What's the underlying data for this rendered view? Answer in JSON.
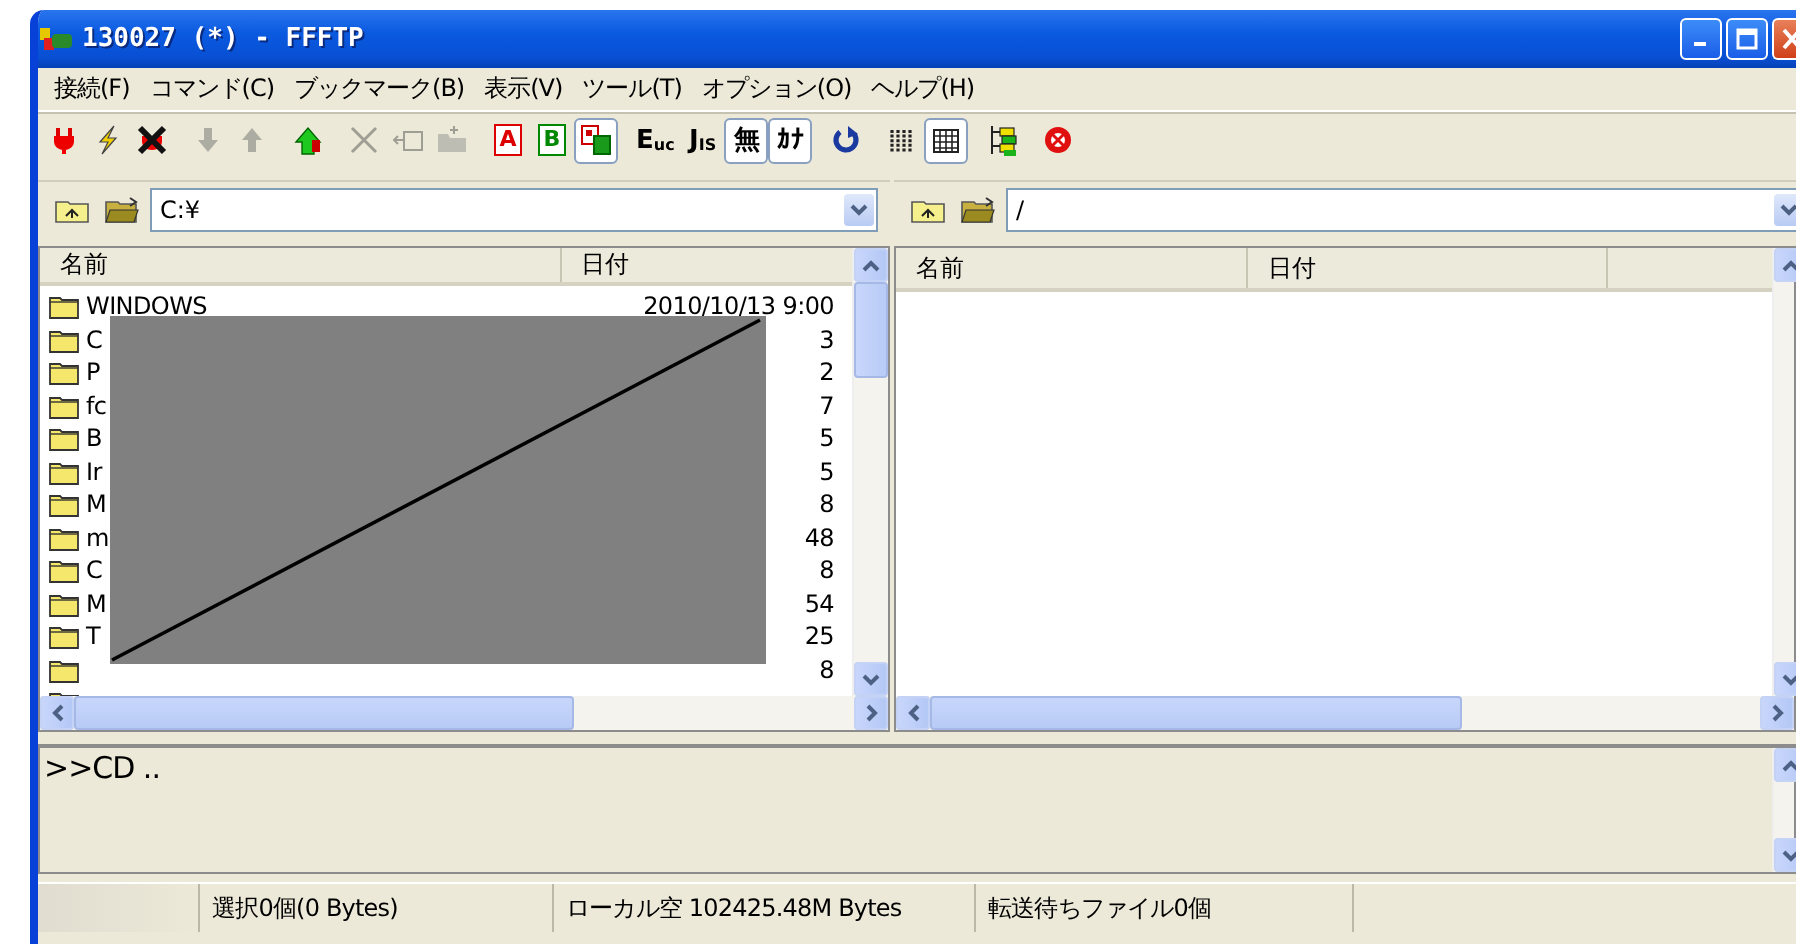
{
  "window": {
    "title": "130027 (*) - FFFTP"
  },
  "menu": [
    "接続(F)",
    "コマンド(C)",
    "ブックマーク(B)",
    "表示(V)",
    "ツール(T)",
    "オプション(O)",
    "ヘルプ(H)"
  ],
  "toolbar": [
    {
      "kind": "connect",
      "selected": false,
      "disabled": false
    },
    {
      "kind": "quick-connect",
      "selected": false,
      "disabled": false
    },
    {
      "kind": "disconnect",
      "selected": false,
      "disabled": false
    },
    {
      "kind": "download",
      "selected": false,
      "disabled": true
    },
    {
      "kind": "upload",
      "selected": false,
      "disabled": true
    },
    {
      "kind": "mirror-upload",
      "selected": false,
      "disabled": false
    },
    {
      "kind": "delete",
      "selected": false,
      "disabled": true
    },
    {
      "kind": "rename",
      "selected": false,
      "disabled": true
    },
    {
      "kind": "new-folder",
      "selected": false,
      "disabled": true
    },
    {
      "kind": "ascii",
      "label": "A",
      "selected": false,
      "disabled": false
    },
    {
      "kind": "binary",
      "label": "B",
      "selected": false,
      "disabled": false
    },
    {
      "kind": "auto-mode",
      "selected": true,
      "disabled": false
    },
    {
      "kind": "code",
      "label": "E$_{uc}$",
      "selected": false,
      "disabled": false
    },
    {
      "kind": "code",
      "label": "J$_{IS}$",
      "selected": false,
      "disabled": false
    },
    {
      "kind": "code",
      "label": "無",
      "selected": true,
      "disabled": false
    },
    {
      "kind": "code",
      "label": "ｶﾅ",
      "selected": true,
      "disabled": false
    },
    {
      "kind": "refresh",
      "selected": false,
      "disabled": false
    },
    {
      "kind": "list-view",
      "selected": false,
      "disabled": false
    },
    {
      "kind": "detail-view",
      "selected": true,
      "disabled": false
    },
    {
      "kind": "tree",
      "selected": false,
      "disabled": false
    },
    {
      "kind": "stop",
      "selected": false,
      "disabled": false
    }
  ],
  "local": {
    "path": "C:¥",
    "columns": [
      "名前",
      "日付"
    ],
    "rows": [
      {
        "name": "WINDOWS",
        "date": "2010/10/13  9:00"
      },
      {
        "name": "C",
        "date": "3"
      },
      {
        "name": "P",
        "date": "2"
      },
      {
        "name": "fc",
        "date": "7"
      },
      {
        "name": "B",
        "date": "5"
      },
      {
        "name": "Ir",
        "date": "5"
      },
      {
        "name": "M",
        "date": "8"
      },
      {
        "name": "m",
        "date": "48"
      },
      {
        "name": "C",
        "date": "8"
      },
      {
        "name": "M",
        "date": "54"
      },
      {
        "name": "T",
        "date": "25"
      },
      {
        "name": "",
        "date": "8"
      }
    ]
  },
  "remote": {
    "path": "/",
    "columns": [
      "名前",
      "日付"
    ]
  },
  "log": ">>CD ..",
  "status_bar": [
    "選択0個(0 Bytes)",
    "ローカル空 102425.48M Bytes",
    "転送待ちファイル0個"
  ]
}
